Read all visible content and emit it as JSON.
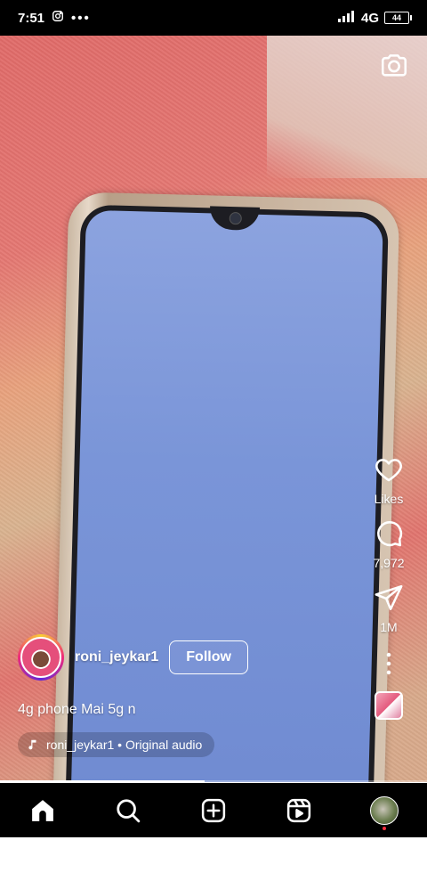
{
  "status_bar": {
    "time": "7:51",
    "network": "4G",
    "battery": "44"
  },
  "post": {
    "username": "roni_jeykar1",
    "follow_label": "Follow",
    "caption": "4g phone Mai 5g n",
    "audio": "roni_jeykar1 • Original audio",
    "progress_fraction": 0.48
  },
  "actions": {
    "likes_label": "Likes",
    "comments_count": "7,972",
    "shares_count": "1M"
  },
  "icons": {
    "camera": "camera-icon",
    "like": "heart-icon",
    "comment": "comment-icon",
    "share": "send-icon",
    "more": "more-vertical-icon",
    "home": "home-icon",
    "search": "search-icon",
    "create": "plus-square-icon",
    "reels": "reels-icon"
  },
  "colors": {
    "nav_background": "#000000",
    "notification_dot": "#ff3040"
  }
}
